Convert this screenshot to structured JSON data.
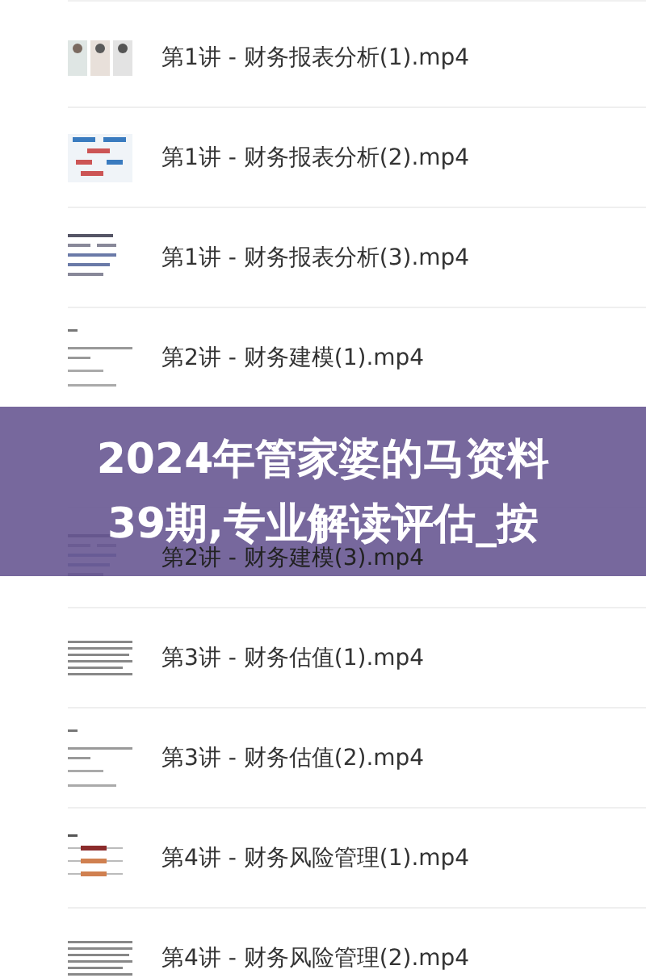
{
  "files": [
    {
      "name": "第1讲 - 财务报表分析(1).mp4",
      "kind": "figures"
    },
    {
      "name": "第1讲 - 财务报表分析(2).mp4",
      "kind": "diagram"
    },
    {
      "name": "第1讲 - 财务报表分析(3).mp4",
      "kind": "table"
    },
    {
      "name": "第2讲 - 财务建模(1).mp4",
      "kind": "sparse"
    },
    {
      "name": "第2讲 - 财务建模(3).mp4",
      "kind": "table"
    },
    {
      "name": "第3讲 - 财务估值(1).mp4",
      "kind": "text"
    },
    {
      "name": "第3讲 - 财务估值(2).mp4",
      "kind": "sparse"
    },
    {
      "name": "第4讲 - 财务风险管理(1).mp4",
      "kind": "bars"
    },
    {
      "name": "第4讲 - 财务风险管理(2).mp4",
      "kind": "text"
    }
  ],
  "banner": {
    "title": "2024年管家婆的马资料39期,专业解读评估_按"
  }
}
